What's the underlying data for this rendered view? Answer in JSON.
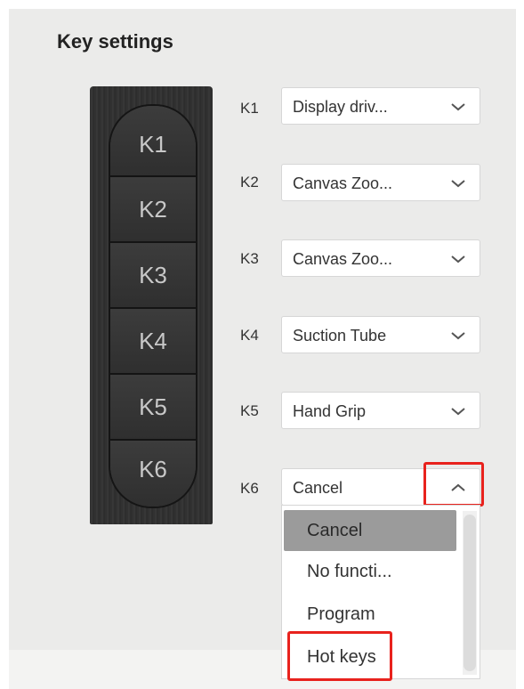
{
  "title": "Key settings",
  "device": {
    "keys": [
      "K1",
      "K2",
      "K3",
      "K4",
      "K5",
      "K6"
    ]
  },
  "rows": [
    {
      "label": "K1",
      "value": "Display driv...",
      "expanded": false
    },
    {
      "label": "K2",
      "value": "Canvas Zoo...",
      "expanded": false
    },
    {
      "label": "K3",
      "value": "Canvas Zoo...",
      "expanded": false
    },
    {
      "label": "K4",
      "value": "Suction Tube",
      "expanded": false
    },
    {
      "label": "K5",
      "value": "Hand Grip",
      "expanded": false
    },
    {
      "label": "K6",
      "value": "Cancel",
      "expanded": true
    }
  ],
  "dropdown": {
    "options": [
      "Cancel",
      "No functi...",
      "Program",
      "Hot keys"
    ],
    "selected": "Cancel"
  },
  "icons": {
    "chevron_down": "chevron-down-icon",
    "chevron_up": "chevron-up-icon"
  },
  "colors": {
    "highlight_box": "#e8221d",
    "selected_option_bg": "#9b9b9b",
    "panel_bg": "#ebebea"
  }
}
